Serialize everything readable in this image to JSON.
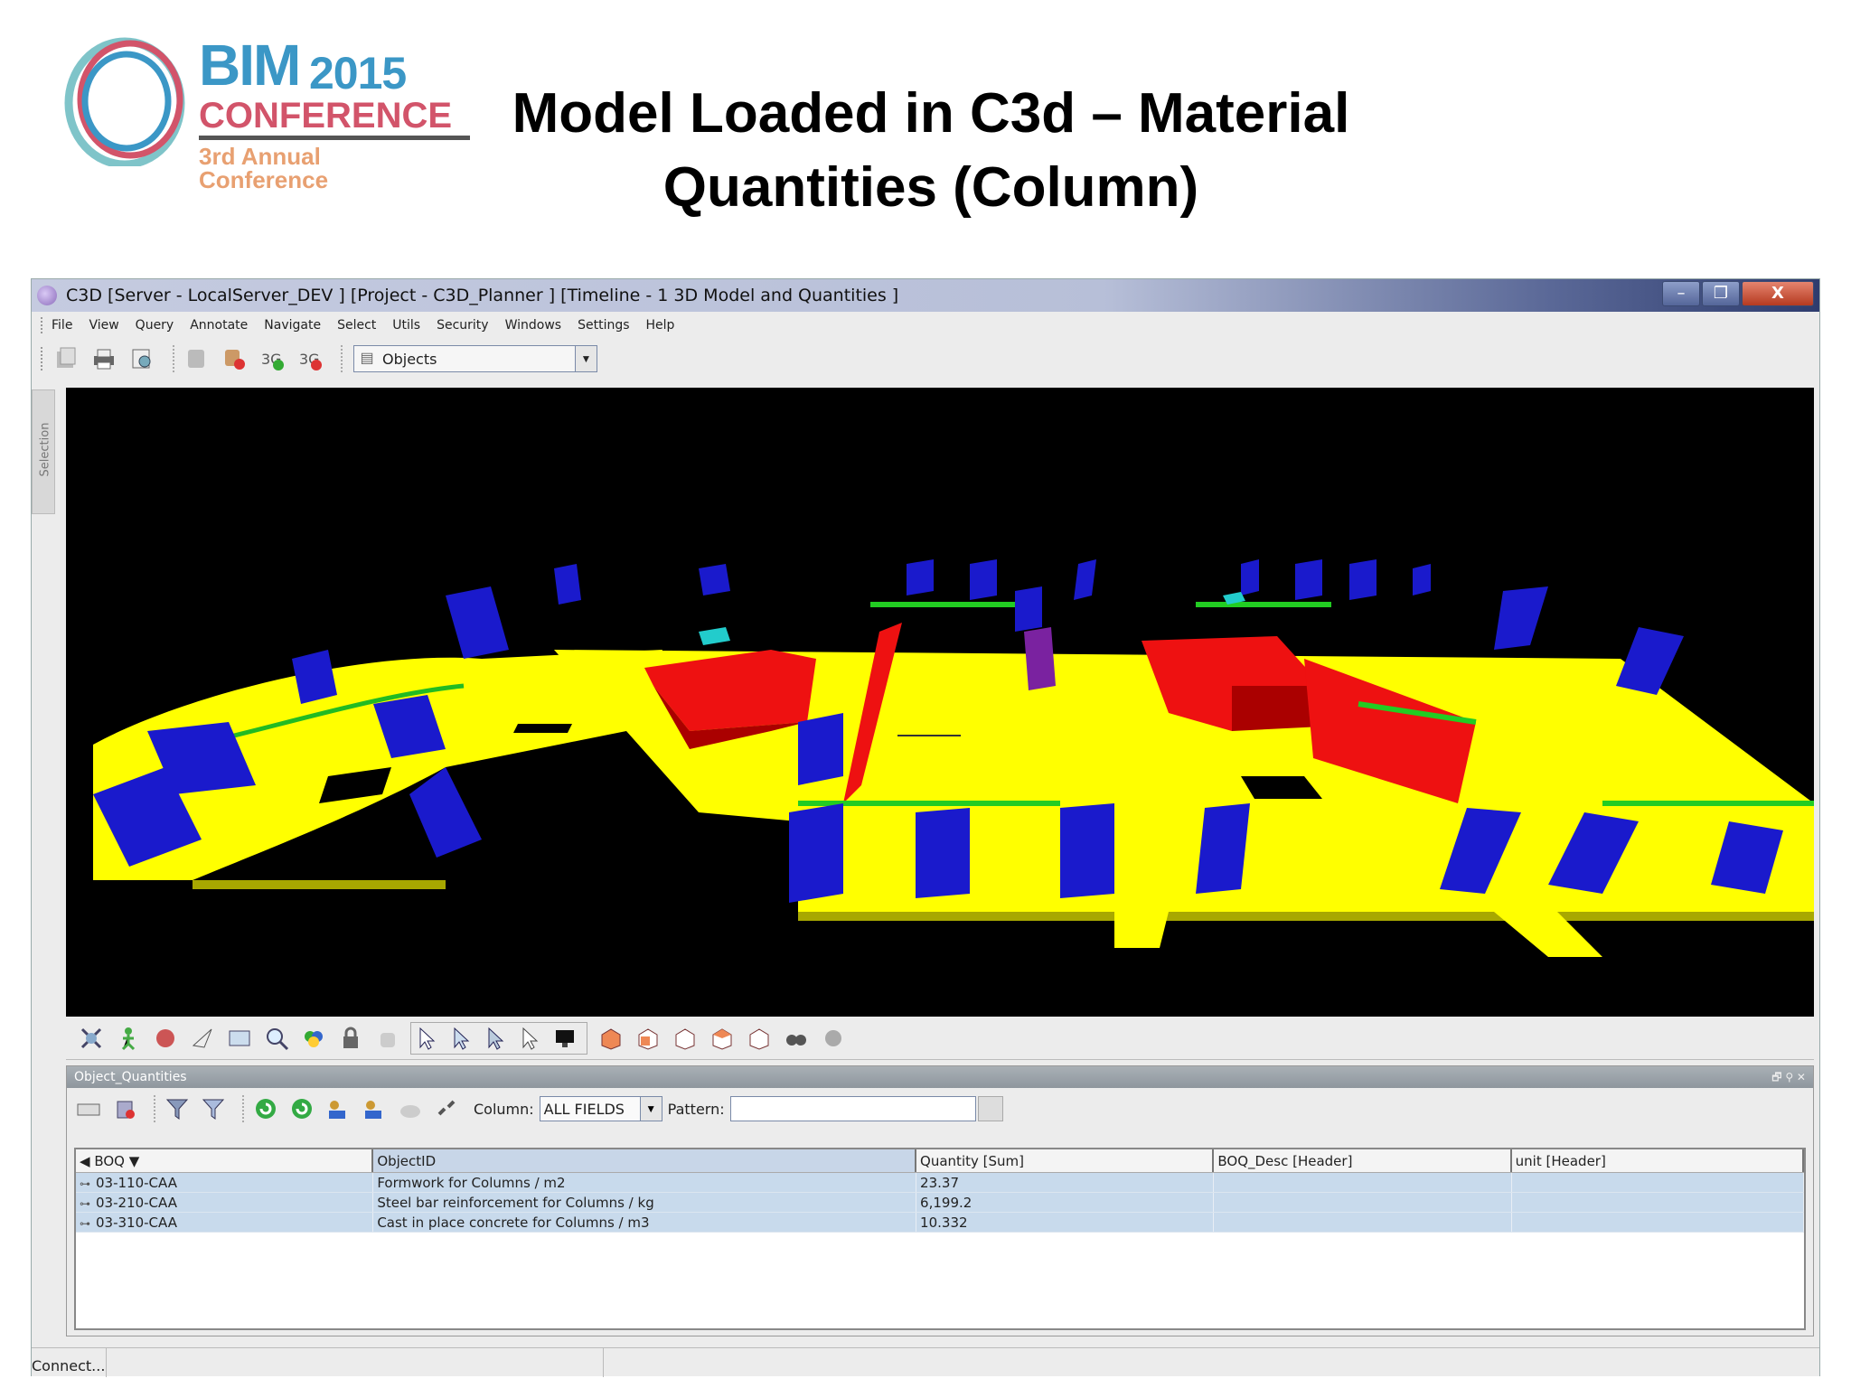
{
  "slide": {
    "logo": {
      "line1": "BIM",
      "year": "2015",
      "line2": "CONFERENCE",
      "line3": "3rd Annual Conference"
    },
    "title_line1": "Model Loaded in C3d – Material",
    "title_line2": "Quantities (Column)"
  },
  "window": {
    "title": "C3D [Server - LocalServer_DEV ] [Project - C3D_Planner ] [Timeline - 1 3D Model and Quantities ]",
    "controls": {
      "minimize": "–",
      "maximize": "❐",
      "close": "X"
    }
  },
  "menu": [
    "File",
    "View",
    "Query",
    "Annotate",
    "Navigate",
    "Select",
    "Utils",
    "Security",
    "Windows",
    "Settings",
    "Help"
  ],
  "toolbar": {
    "icons": [
      "open-icon",
      "print-icon",
      "print-preview-icon",
      "server-icon",
      "delete-server-icon",
      "add-model-icon",
      "remove-model-icon"
    ],
    "objects_combo": "Objects"
  },
  "side_tab": "Selection",
  "viewport": {
    "description_colors": {
      "slab": "#ffff00",
      "column": "#1a1acc",
      "wall": "#ee1111",
      "edge": "#22cc22"
    }
  },
  "panel": {
    "title": "Object_Quantities",
    "header_controls": "🗗 ⚲ ✕",
    "column_label": "Column:",
    "column_value": "ALL FIELDS",
    "pattern_label": "Pattern:",
    "pattern_value": "",
    "table": {
      "headers": [
        "BOQ ▼",
        "ObjectID",
        "Quantity [Sum]",
        "BOQ_Desc [Header]",
        "unit [Header]"
      ],
      "rows": [
        {
          "boq": "03-110-CAA",
          "object": "Formwork for Columns / m2",
          "qty": "23.37",
          "desc": "",
          "unit": ""
        },
        {
          "boq": "03-210-CAA",
          "object": "Steel bar reinforcement for Columns / kg",
          "qty": "6,199.2",
          "desc": "",
          "unit": ""
        },
        {
          "boq": "03-310-CAA",
          "object": "Cast in place concrete for Columns / m3",
          "qty": "10.332",
          "desc": "",
          "unit": ""
        }
      ]
    }
  },
  "status": {
    "text": "Connect..."
  }
}
